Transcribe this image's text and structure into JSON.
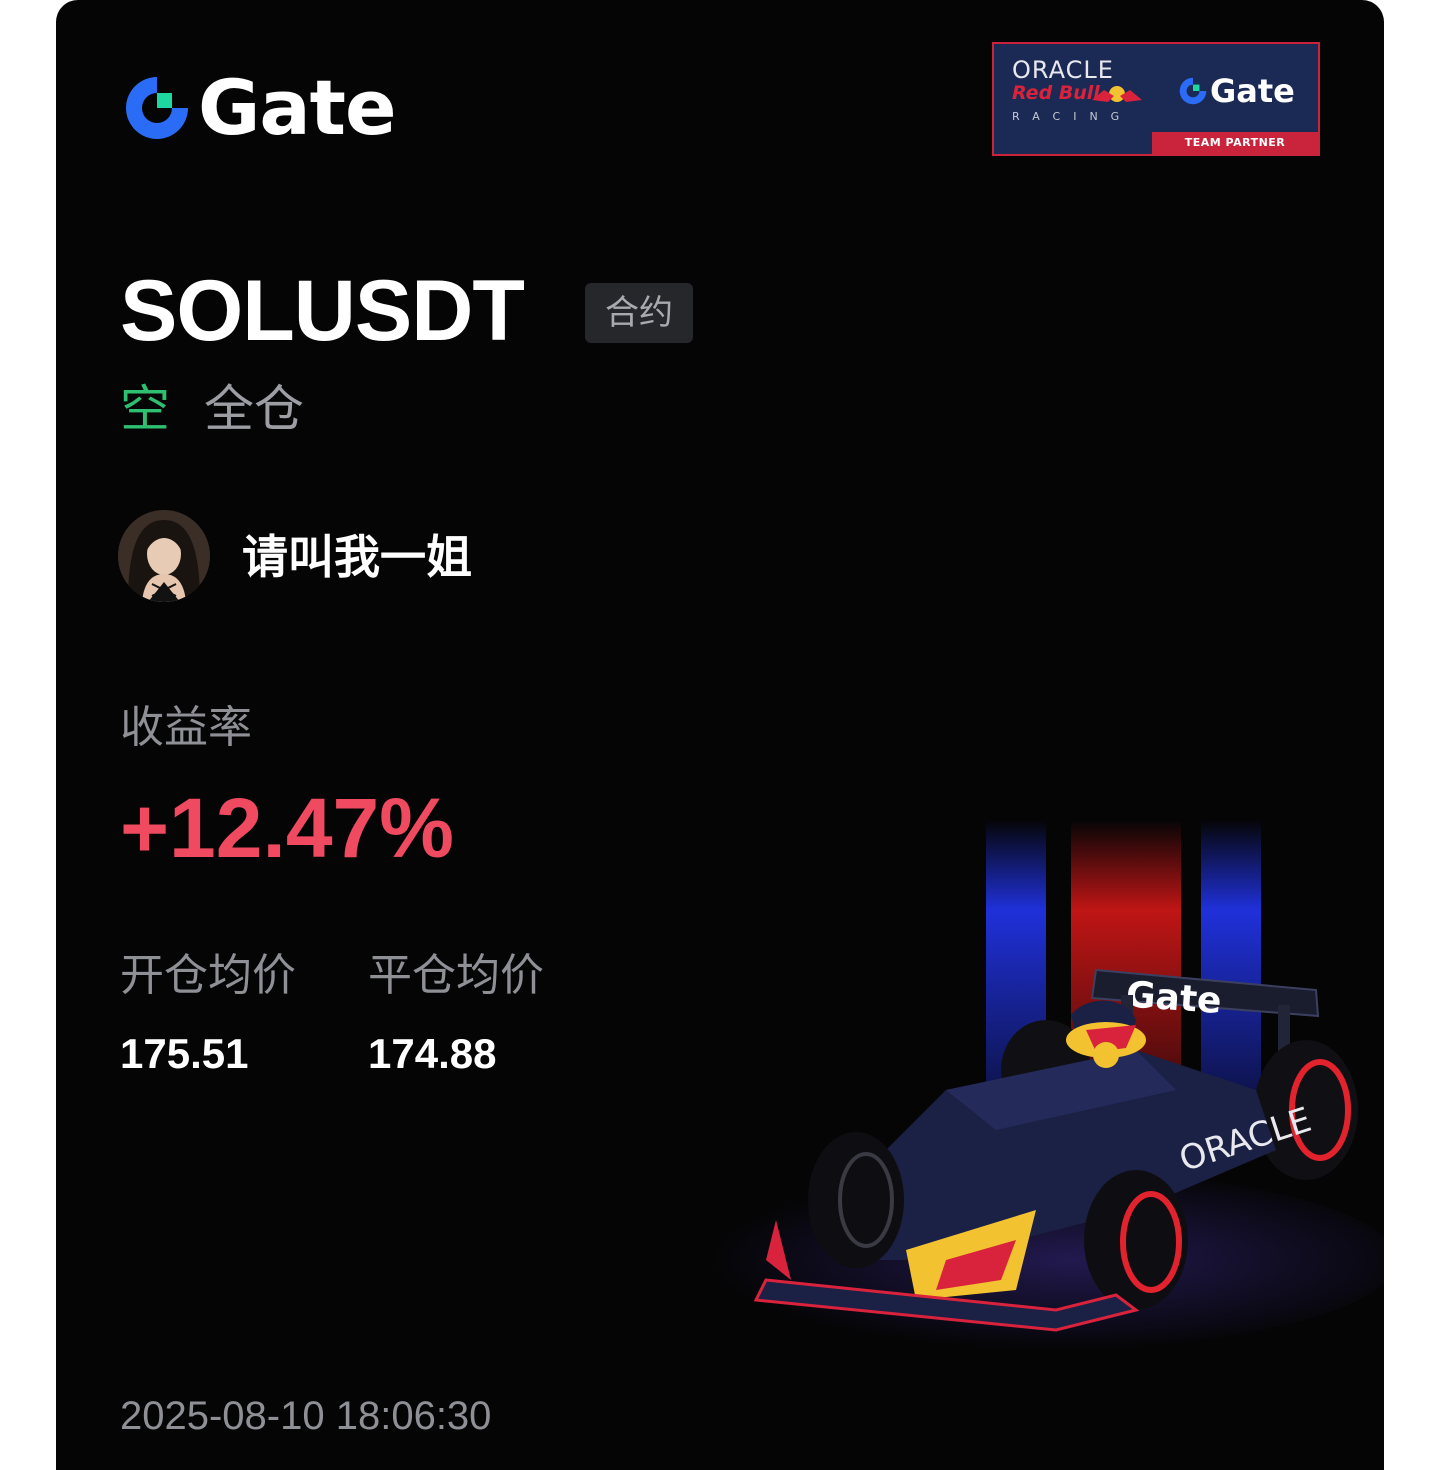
{
  "brand": {
    "name": "Gate",
    "logo_icon": "gate-logo-icon",
    "accent_color": "#2b6cf6",
    "accent_green": "#1dd6a0"
  },
  "partner_badge": {
    "oracle": "ORACLE",
    "red_bull": "Red Bull",
    "racing": "RACING",
    "gate": "Gate",
    "team_partner": "TEAM PARTNER",
    "bg_color": "#1b2a55",
    "border_color": "#c9243b"
  },
  "position": {
    "pair": "SOLUSDT",
    "type_tag": "合约",
    "direction": "空",
    "direction_color": "#2fbf71",
    "margin_mode": "全仓"
  },
  "user": {
    "avatar_icon": "user-avatar",
    "name": "请叫我一姐"
  },
  "pnl": {
    "roi_label": "收益率",
    "roi_value": "+12.47%",
    "roi_color": "#ef4a5f"
  },
  "prices": {
    "open_label": "开仓均价",
    "open_value": "175.51",
    "close_label": "平仓均价",
    "close_value": "174.88"
  },
  "footer": {
    "timestamp": "2025-08-10 18:06:30"
  },
  "illustration": {
    "icon": "f1-car-illustration",
    "wing_text": "Gate",
    "sidepod_text": "ORACLE"
  }
}
